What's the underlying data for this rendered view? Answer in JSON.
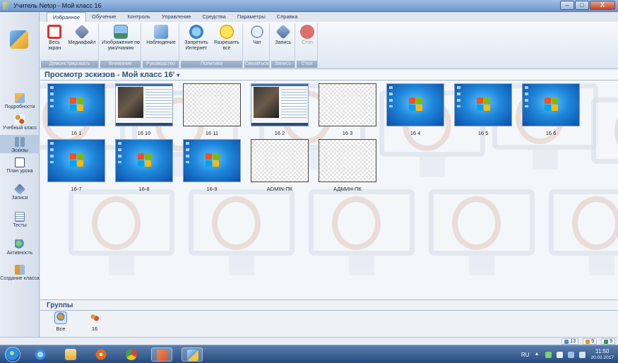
{
  "window": {
    "title": "Учитель Netop - Мой класс 16",
    "controls": [
      "–",
      "□",
      "X"
    ]
  },
  "menu_tabs": [
    {
      "label": "Избранное",
      "active": true
    },
    {
      "label": "Обучение",
      "active": false
    },
    {
      "label": "Контроль",
      "active": false
    },
    {
      "label": "Управление",
      "active": false
    },
    {
      "label": "Средства",
      "active": false
    },
    {
      "label": "Параметры",
      "active": false
    },
    {
      "label": "Справка",
      "active": false
    }
  ],
  "ribbon": {
    "groups": [
      {
        "label": "Демонстрировать",
        "buttons": [
          {
            "label": "Весь экран",
            "icon": "monitor-icon",
            "color": "#d9342b"
          },
          {
            "label": "Медиафайл",
            "icon": "media-diamond-icon",
            "color": "#5a6f9a"
          }
        ]
      },
      {
        "label": "Внимание",
        "buttons": [
          {
            "label": "Изображение по умолчанию",
            "icon": "image-icon",
            "color": "#3f8f5a"
          }
        ]
      },
      {
        "label": "Руководство",
        "buttons": [
          {
            "label": "Наблюдение",
            "icon": "monitor-eye-icon",
            "color": "#4d8ed0"
          }
        ]
      },
      {
        "label": "Политика",
        "buttons": [
          {
            "label": "Запретить Интернет",
            "icon": "globe-block-icon",
            "color": "#3f7fc4"
          },
          {
            "label": "Разрешить все",
            "icon": "smiley-icon",
            "color": "#f2c316"
          }
        ]
      },
      {
        "label": "Связаться",
        "buttons": [
          {
            "label": "Чат",
            "icon": "chat-icon",
            "color": "#7d9bc2"
          }
        ]
      },
      {
        "label": "Запись",
        "buttons": [
          {
            "label": "Запись",
            "icon": "record-icon",
            "color": "#4b6fa8"
          }
        ]
      },
      {
        "label": "Стоп",
        "buttons": [
          {
            "label": "Стоп",
            "icon": "stop-sign-icon",
            "color": "#d4433a",
            "disabled": true
          }
        ]
      }
    ]
  },
  "sidebar": {
    "items": [
      {
        "label": "Подробности",
        "icon": "details-icon",
        "active": false
      },
      {
        "label": "Учебный класс",
        "icon": "classroom-icon",
        "active": false
      },
      {
        "label": "Эскизы",
        "icon": "thumbnails-icon",
        "active": true
      },
      {
        "label": "План урока",
        "icon": "lesson-plan-icon",
        "active": false
      },
      {
        "label": "Записи",
        "icon": "recordings-icon",
        "active": false
      },
      {
        "label": "Тесты",
        "icon": "tests-icon",
        "active": false
      },
      {
        "label": "Активность",
        "icon": "activity-icon",
        "active": false
      },
      {
        "label": "Создание класса",
        "icon": "create-class-icon",
        "active": false
      }
    ]
  },
  "view": {
    "title": "Просмотр эскизов - Мой класс 16'",
    "caret": "▾"
  },
  "thumbnails": [
    {
      "label": "16 1",
      "kind": "win7"
    },
    {
      "label": "16 10",
      "kind": "desktop"
    },
    {
      "label": "16 11",
      "kind": "blank"
    },
    {
      "label": "16 2",
      "kind": "desktop"
    },
    {
      "label": "16 3",
      "kind": "blank"
    },
    {
      "label": "16 4",
      "kind": "win7"
    },
    {
      "label": "16 5",
      "kind": "win7"
    },
    {
      "label": "16 6",
      "kind": "win7"
    },
    {
      "label": "16-7",
      "kind": "win7"
    },
    {
      "label": "16-8",
      "kind": "win7"
    },
    {
      "label": "16-9",
      "kind": "win7"
    },
    {
      "label": "ADMIN-ПК",
      "kind": "blank"
    },
    {
      "label": "АДМИН-ПК",
      "kind": "blank"
    }
  ],
  "groups": {
    "title": "Группы",
    "items": [
      {
        "label": "Все",
        "icon": "all-students-icon"
      },
      {
        "label": "16",
        "icon": "group-icon"
      }
    ]
  },
  "statusbar": {
    "counters": [
      {
        "value": "13",
        "icon": "computers-icon",
        "color": "#4d8ed0"
      },
      {
        "value": "9",
        "icon": "students-icon",
        "color": "#e09a2b"
      },
      {
        "value": "9",
        "icon": "connected-icon",
        "color": "#3f8f5a"
      }
    ]
  },
  "taskbar": {
    "apps": [
      {
        "icon": "ie-icon",
        "color": "#3a8fe0"
      },
      {
        "icon": "explorer-folder-icon",
        "color": "#f0c95a"
      },
      {
        "icon": "media-player-icon",
        "color": "#e06a1e"
      },
      {
        "icon": "chrome-icon",
        "color": "#d8433a"
      },
      {
        "icon": "powerpoint-icon",
        "color": "#d0542c"
      },
      {
        "icon": "netop-teacher-icon",
        "color": "#5da0e0"
      }
    ],
    "language": "RU",
    "clock_time": "11:50",
    "clock_date": "20.02.2017"
  }
}
